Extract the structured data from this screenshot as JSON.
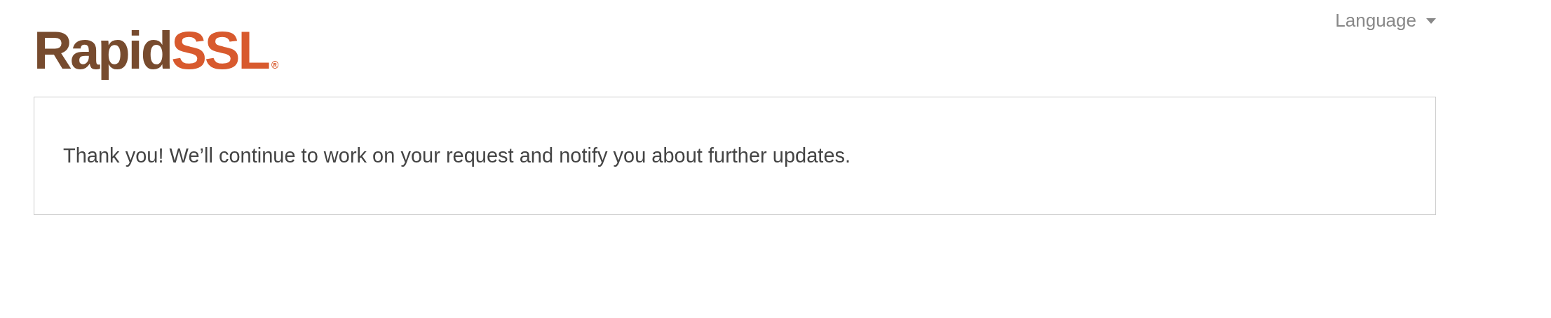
{
  "header": {
    "logo": {
      "first": "Rapid",
      "second": "SSL",
      "mark": "®"
    },
    "language_menu": {
      "label": "Language"
    }
  },
  "message": {
    "text": "Thank you! We’ll continue to work on your request and notify you about further updates."
  }
}
